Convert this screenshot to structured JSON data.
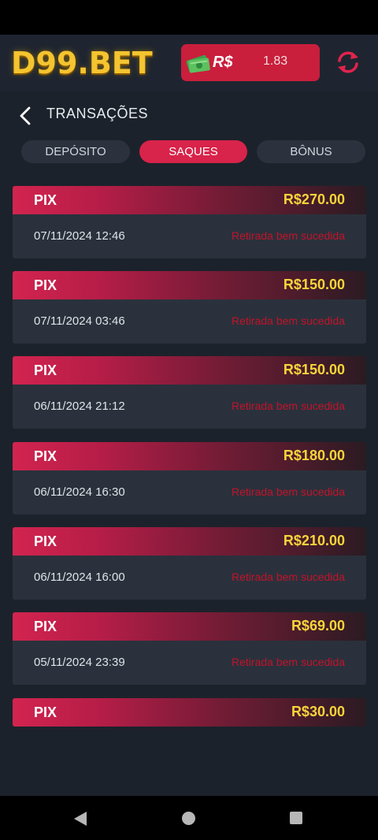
{
  "header": {
    "logo_text": "D99.BET",
    "currency": "R$",
    "balance": "1.83",
    "icons": {
      "cash": "cash-icon",
      "refresh": "refresh-icon"
    }
  },
  "title": {
    "text": "TRANSAÇÕES",
    "back_icon": "chevron-left-icon"
  },
  "tabs": [
    {
      "label": "DEPÓSITO",
      "active": false
    },
    {
      "label": "SAQUES",
      "active": true
    },
    {
      "label": "BÔNUS",
      "active": false
    }
  ],
  "transactions": [
    {
      "method": "PIX",
      "amount": "R$270.00",
      "datetime": "07/11/2024 12:46",
      "status": "Retirada bem sucedida"
    },
    {
      "method": "PIX",
      "amount": "R$150.00",
      "datetime": "07/11/2024 03:46",
      "status": "Retirada bem sucedida"
    },
    {
      "method": "PIX",
      "amount": "R$150.00",
      "datetime": "06/11/2024 21:12",
      "status": "Retirada bem sucedida"
    },
    {
      "method": "PIX",
      "amount": "R$180.00",
      "datetime": "06/11/2024 16:30",
      "status": "Retirada bem sucedida"
    },
    {
      "method": "PIX",
      "amount": "R$210.00",
      "datetime": "06/11/2024 16:00",
      "status": "Retirada bem sucedida"
    },
    {
      "method": "PIX",
      "amount": "R$69.00",
      "datetime": "05/11/2024 23:39",
      "status": "Retirada bem sucedida"
    },
    {
      "method": "PIX",
      "amount": "R$30.00"
    }
  ],
  "colors": {
    "accent": "#d8234a",
    "amount": "#f8d43a",
    "status": "#c4122a",
    "background": "#1c222b"
  }
}
